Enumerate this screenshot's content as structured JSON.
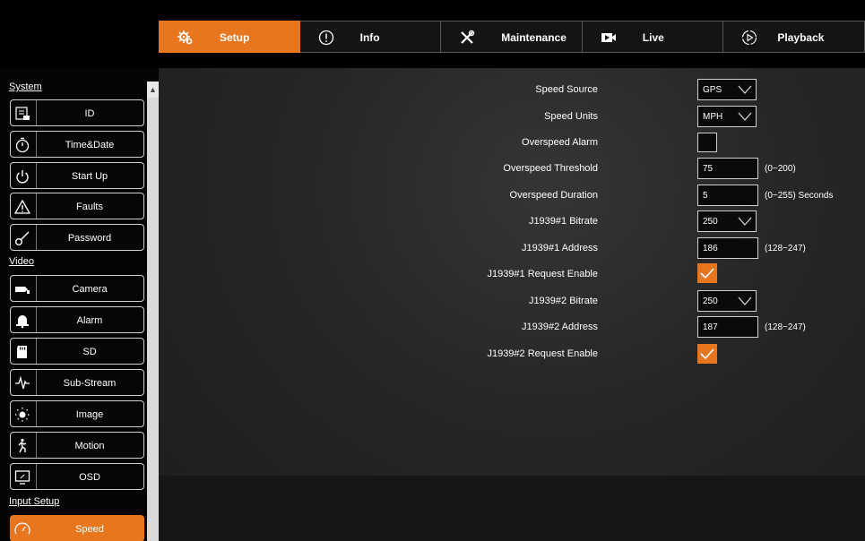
{
  "tabs": [
    {
      "label": "Setup",
      "icon": "gears-icon",
      "active": true
    },
    {
      "label": "Info",
      "icon": "info-circle-icon"
    },
    {
      "label": "Maintenance",
      "icon": "tools-icon"
    },
    {
      "label": "Live",
      "icon": "video-camera-icon"
    },
    {
      "label": "Playback",
      "icon": "play-circle-icon"
    }
  ],
  "sidebar": {
    "sections": {
      "system": "System",
      "video": "Video",
      "input_setup": "Input Setup"
    },
    "items": [
      {
        "label": "ID",
        "icon": "id-card-icon"
      },
      {
        "label": "Time&Date",
        "icon": "stopwatch-icon"
      },
      {
        "label": "Start Up",
        "icon": "power-icon"
      },
      {
        "label": "Faults",
        "icon": "warning-icon"
      },
      {
        "label": "Password",
        "icon": "key-icon"
      },
      {
        "label": "Camera",
        "icon": "camera-icon"
      },
      {
        "label": "Alarm",
        "icon": "bell-icon"
      },
      {
        "label": "SD",
        "icon": "sd-card-icon"
      },
      {
        "label": "Sub-Stream",
        "icon": "waveform-icon"
      },
      {
        "label": "Image",
        "icon": "brightness-icon"
      },
      {
        "label": "Motion",
        "icon": "running-person-icon"
      },
      {
        "label": "OSD",
        "icon": "monitor-icon"
      },
      {
        "label": "Speed",
        "icon": "speedometer-icon",
        "active": true
      }
    ]
  },
  "form": {
    "speed_source": {
      "label": "Speed Source",
      "value": "GPS"
    },
    "speed_units": {
      "label": "Speed Units",
      "value": "MPH"
    },
    "overspeed_alarm": {
      "label": "Overspeed Alarm",
      "checked": false
    },
    "overspeed_threshold": {
      "label": "Overspeed Threshold",
      "value": "75",
      "range": "(0~200)"
    },
    "overspeed_duration": {
      "label": "Overspeed Duration",
      "value": "5",
      "range": "(0~255) Seconds"
    },
    "j1939_1_bitrate": {
      "label": "J1939#1 Bitrate",
      "value": "250"
    },
    "j1939_1_address": {
      "label": "J1939#1 Address",
      "value": "186",
      "range": "(128~247)"
    },
    "j1939_1_request": {
      "label": "J1939#1 Request Enable",
      "checked": true
    },
    "j1939_2_bitrate": {
      "label": "J1939#2 Bitrate",
      "value": "250"
    },
    "j1939_2_address": {
      "label": "J1939#2 Address",
      "value": "187",
      "range": "(128~247)"
    },
    "j1939_2_request": {
      "label": "J1939#2 Request Enable",
      "checked": true
    }
  },
  "colors": {
    "accent": "#e8761e",
    "background": "#262626",
    "sidebar": "#050505"
  }
}
